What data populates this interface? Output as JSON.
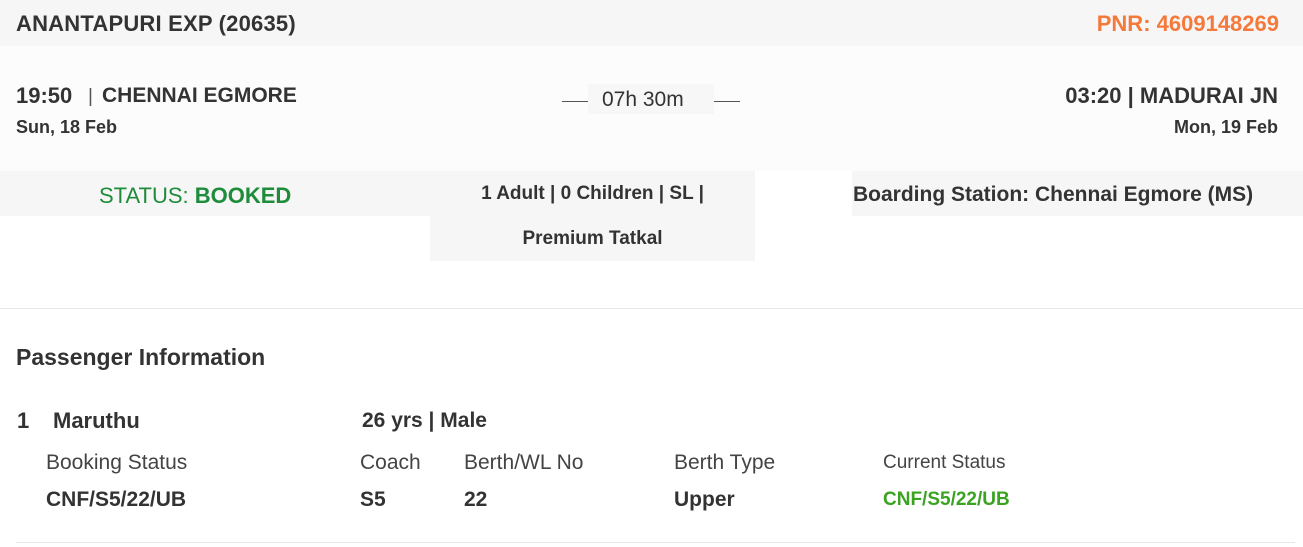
{
  "header": {
    "train_name": "ANANTAPURI EXP (20635)",
    "pnr": "PNR: 4609148269"
  },
  "journey": {
    "departure": {
      "time": "19:50",
      "separator": "|",
      "station": "CHENNAI EGMORE",
      "date": "Sun, 18 Feb"
    },
    "duration": "07h 30m",
    "arrival": {
      "line": "03:20 | MADURAI JN",
      "date": "Mon, 19 Feb"
    }
  },
  "booking": {
    "status_label": "STATUS: ",
    "status_value": "BOOKED",
    "passengers_line1": "1 Adult | 0 Children | SL |",
    "passengers_line2": "Premium Tatkal",
    "boarding_station": "Boarding Station: Chennai Egmore (MS)"
  },
  "passenger_section": {
    "title": "Passenger Information",
    "passengers": [
      {
        "index": "1",
        "name": "Maruthu",
        "age_gender": "26 yrs | Male",
        "labels": {
          "booking_status": "Booking Status",
          "coach": "Coach",
          "berth": "Berth/WL No",
          "berth_type": "Berth Type",
          "current_status": "Current Status"
        },
        "values": {
          "booking_status": "CNF/S5/22/UB",
          "coach": "S5",
          "berth": "22",
          "berth_type": "Upper",
          "current_status": "CNF/S5/22/UB"
        }
      }
    ]
  },
  "colors": {
    "pnr_orange": "#f5793b",
    "status_green": "#1e8c3a",
    "current_status_green": "#3aa321",
    "text_dark": "#333333",
    "panel_gray": "#f6f6f6"
  }
}
